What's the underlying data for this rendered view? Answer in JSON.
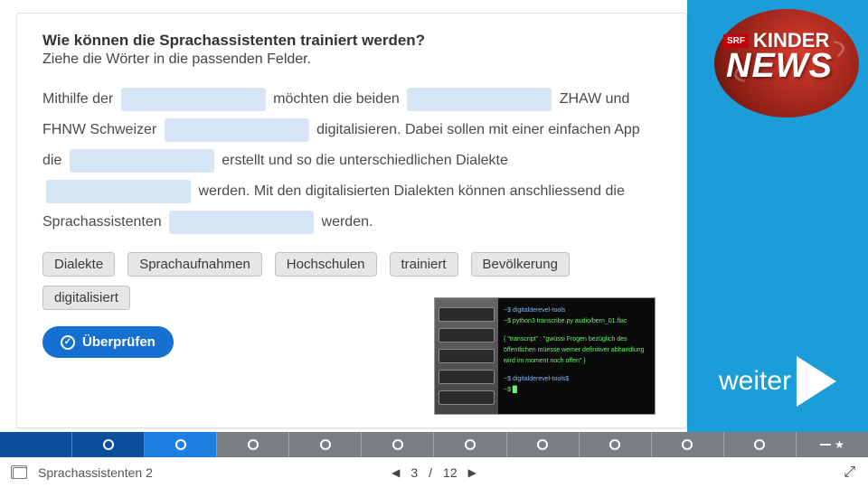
{
  "header": {
    "srf": "SRF",
    "kinder": "KINDER",
    "news": "NEWS"
  },
  "next": {
    "label": "weiter"
  },
  "question": {
    "title": "Wie können die Sprachassistenten trainiert werden?",
    "subtitle": "Ziehe die Wörter in die passenden Felder.",
    "cloze": {
      "t1": "Mithilfe der ",
      "t2": " möchten die beiden ",
      "t3": " ZHAW und FHNW Schweizer ",
      "t4": " digitalisieren. Dabei sollen mit einer einfachen App die ",
      "t5": " erstellt und so die unterschiedlichen Dialekte ",
      "t6": " werden. Mit den digitalisierten Dialekten können anschliessend die Sprachassistenten ",
      "t7": " werden."
    },
    "words": [
      "Dialekte",
      "Sprachaufnahmen",
      "Hochschulen",
      "trainiert",
      "Bevölkerung",
      "digitalisiert"
    ],
    "check": "Überprüfen"
  },
  "progress": {
    "total": 12,
    "done": 2,
    "current": 3
  },
  "footer": {
    "title": "Sprachassistenten 2",
    "page": "3",
    "sep": "/",
    "total": "12"
  }
}
